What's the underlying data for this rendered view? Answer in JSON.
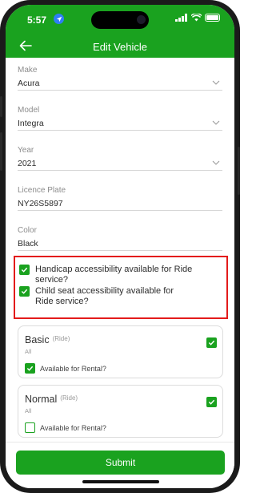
{
  "status": {
    "time": "5:57"
  },
  "header": {
    "title": "Edit Vehicle"
  },
  "fields": [
    {
      "label": "Make",
      "value": "Acura",
      "dropdown": true
    },
    {
      "label": "Model",
      "value": "Integra",
      "dropdown": true
    },
    {
      "label": "Year",
      "value": "2021",
      "dropdown": true
    },
    {
      "label": "Licence Plate",
      "value": "NY26S5897",
      "dropdown": false
    },
    {
      "label": "Color",
      "value": "Black",
      "dropdown": false
    }
  ],
  "accessibility": [
    {
      "text": "Handicap accessibility available for Ride service?",
      "checked": true
    },
    {
      "text": "Child seat accessibility available for Ride service?",
      "checked": true
    }
  ],
  "cards": [
    {
      "title": "Basic",
      "sub": "(Ride)",
      "all": "All",
      "selected": true,
      "rental_label": "Available for Rental?",
      "rental_checked": true
    },
    {
      "title": "Normal",
      "sub": "(Ride)",
      "all": "All",
      "selected": true,
      "rental_label": "Available for Rental?",
      "rental_checked": false
    }
  ],
  "submit_label": "Submit",
  "colors": {
    "brand": "#1aa21f",
    "highlight": "#e31b1b"
  }
}
